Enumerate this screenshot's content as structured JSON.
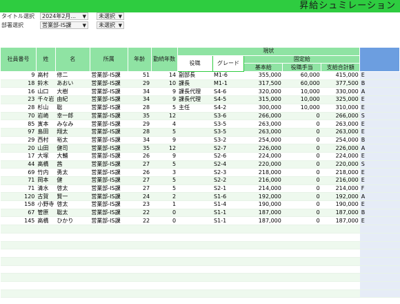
{
  "app": {
    "title": "昇給シュミレーション"
  },
  "filters": [
    {
      "label": "タイトル選択",
      "value": "2024年2月...",
      "extra": "未選択"
    },
    {
      "label": "部署選択",
      "value": "営業部-IS課",
      "extra": "未選択"
    }
  ],
  "headers": {
    "id": "社員番号",
    "last": "姓",
    "first": "名",
    "dept": "所属",
    "age": "年齢",
    "years": "勤続年数",
    "current": "現状",
    "title": "役職",
    "grade": "グレード",
    "fixed": "固定給",
    "base": "基本給",
    "allowance": "役職手当",
    "total": "支給合計額"
  },
  "colors": {
    "topbar": "#2ecc40",
    "header": "#8fe3a3",
    "side": "#6c9ee0"
  },
  "rows": [
    {
      "id": "9",
      "last": "高村",
      "first": "修二",
      "dept": "営業部-IS課",
      "age": "51",
      "years": "14",
      "title": "副部長",
      "grade": "M1-6",
      "base": "355,000",
      "allowance": "60,000",
      "total": "415,000",
      "side": "E"
    },
    {
      "id": "18",
      "last": "鈴木",
      "first": "あおい",
      "dept": "営業部-IS課",
      "age": "29",
      "years": "10",
      "title": "課長",
      "grade": "M1-1",
      "base": "317,500",
      "allowance": "60,000",
      "total": "377,500",
      "side": "B"
    },
    {
      "id": "16",
      "last": "山口",
      "first": "大樹",
      "dept": "営業部-IS課",
      "age": "34",
      "years": "9",
      "title": "課長代理",
      "grade": "S4-6",
      "base": "320,000",
      "allowance": "10,000",
      "total": "330,000",
      "side": "A"
    },
    {
      "id": "23",
      "last": "千々岩",
      "first": "由紀",
      "dept": "営業部-IS課",
      "age": "34",
      "years": "9",
      "title": "課長代理",
      "grade": "S4-5",
      "base": "315,000",
      "allowance": "10,000",
      "total": "325,000",
      "side": "E"
    },
    {
      "id": "28",
      "last": "杉山",
      "first": "聡",
      "dept": "営業部-IS課",
      "age": "28",
      "years": "5",
      "title": "主任",
      "grade": "S4-2",
      "base": "300,000",
      "allowance": "10,000",
      "total": "310,000",
      "side": "E"
    },
    {
      "id": "70",
      "last": "岩崎",
      "first": "幸一郎",
      "dept": "営業部-IS課",
      "age": "35",
      "years": "12",
      "title": "",
      "grade": "S3-6",
      "base": "266,000",
      "allowance": "0",
      "total": "266,000",
      "side": "S"
    },
    {
      "id": "85",
      "last": "寅本",
      "first": "みなみ",
      "dept": "営業部-IS課",
      "age": "29",
      "years": "4",
      "title": "",
      "grade": "S3-5",
      "base": "263,000",
      "allowance": "0",
      "total": "263,000",
      "side": "E"
    },
    {
      "id": "97",
      "last": "島田",
      "first": "翔太",
      "dept": "営業部-IS課",
      "age": "28",
      "years": "5",
      "title": "",
      "grade": "S3-5",
      "base": "263,000",
      "allowance": "0",
      "total": "263,000",
      "side": "E"
    },
    {
      "id": "29",
      "last": "西村",
      "first": "裕太",
      "dept": "営業部-IS課",
      "age": "34",
      "years": "9",
      "title": "",
      "grade": "S3-2",
      "base": "254,000",
      "allowance": "0",
      "total": "254,000",
      "side": "B"
    },
    {
      "id": "20",
      "last": "山田",
      "first": "健司",
      "dept": "営業部-IS課",
      "age": "35",
      "years": "12",
      "title": "",
      "grade": "S2-7",
      "base": "226,000",
      "allowance": "0",
      "total": "226,000",
      "side": "A"
    },
    {
      "id": "17",
      "last": "大塚",
      "first": "大輔",
      "dept": "営業部-IS課",
      "age": "26",
      "years": "9",
      "title": "",
      "grade": "S2-6",
      "base": "224,000",
      "allowance": "0",
      "total": "224,000",
      "side": "E"
    },
    {
      "id": "44",
      "last": "髙橋",
      "first": "茜",
      "dept": "営業部-IS課",
      "age": "27",
      "years": "5",
      "title": "",
      "grade": "S2-4",
      "base": "220,000",
      "allowance": "0",
      "total": "220,000",
      "side": "S"
    },
    {
      "id": "69",
      "last": "竹内",
      "first": "勇太",
      "dept": "営業部-IS課",
      "age": "26",
      "years": "3",
      "title": "",
      "grade": "S2-3",
      "base": "218,000",
      "allowance": "0",
      "total": "218,000",
      "side": "E"
    },
    {
      "id": "71",
      "last": "岡本",
      "first": "健",
      "dept": "営業部-IS課",
      "age": "27",
      "years": "5",
      "title": "",
      "grade": "S2-2",
      "base": "216,000",
      "allowance": "0",
      "total": "216,000",
      "side": "E"
    },
    {
      "id": "71",
      "last": "清水",
      "first": "啓太",
      "dept": "営業部-IS課",
      "age": "27",
      "years": "5",
      "title": "",
      "grade": "S2-1",
      "base": "214,000",
      "allowance": "0",
      "total": "214,000",
      "side": "F"
    },
    {
      "id": "120",
      "last": "古賀",
      "first": "賢一",
      "dept": "営業部-IS課",
      "age": "24",
      "years": "2",
      "title": "",
      "grade": "S1-6",
      "base": "192,000",
      "allowance": "0",
      "total": "192,000",
      "side": "A"
    },
    {
      "id": "158",
      "last": "小野寺",
      "first": "啓太",
      "dept": "営業部-IS課",
      "age": "23",
      "years": "1",
      "title": "",
      "grade": "S1-4",
      "base": "190,000",
      "allowance": "0",
      "total": "190,000",
      "side": "E"
    },
    {
      "id": "67",
      "last": "管原",
      "first": "聡太",
      "dept": "営業部-IS課",
      "age": "22",
      "years": "0",
      "title": "",
      "grade": "S1-1",
      "base": "187,000",
      "allowance": "0",
      "total": "187,000",
      "side": "B"
    },
    {
      "id": "145",
      "last": "高橋",
      "first": "ひかり",
      "dept": "営業部-IS課",
      "age": "22",
      "years": "0",
      "title": "",
      "grade": "S1-1",
      "base": "187,000",
      "allowance": "0",
      "total": "187,000",
      "side": "E"
    }
  ]
}
